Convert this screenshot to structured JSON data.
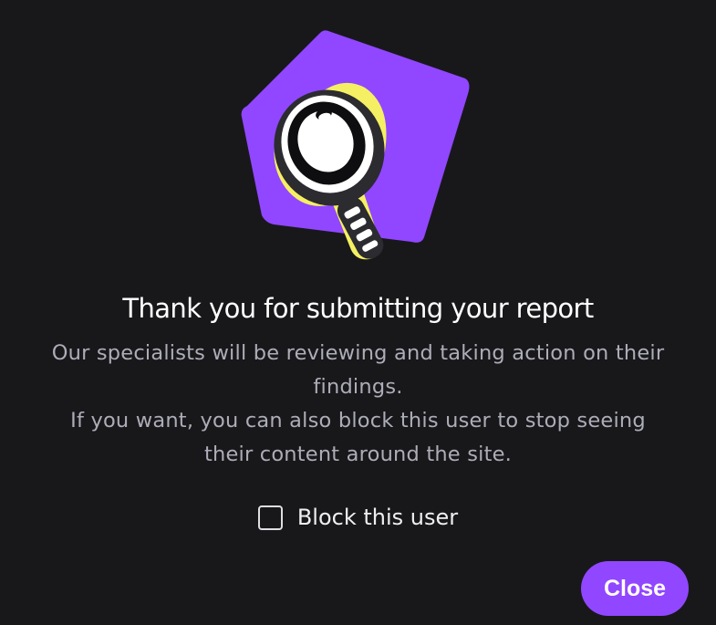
{
  "dialog": {
    "title": "Thank you for submitting your report",
    "body_lines": [
      "Our specialists will be reviewing and taking action on their",
      "findings.",
      "If you want, you can also block this user to stop seeing",
      "their content around the site."
    ],
    "block_checkbox": {
      "label": "Block this user",
      "checked": false
    },
    "close_label": "Close"
  },
  "illustration": {
    "icon": "magnifying-glass-icon"
  },
  "colors": {
    "background": "#18181b",
    "accent": "#9147ff",
    "highlight": "#f5f063",
    "title_text": "#ffffff",
    "body_text": "#adadb8"
  }
}
